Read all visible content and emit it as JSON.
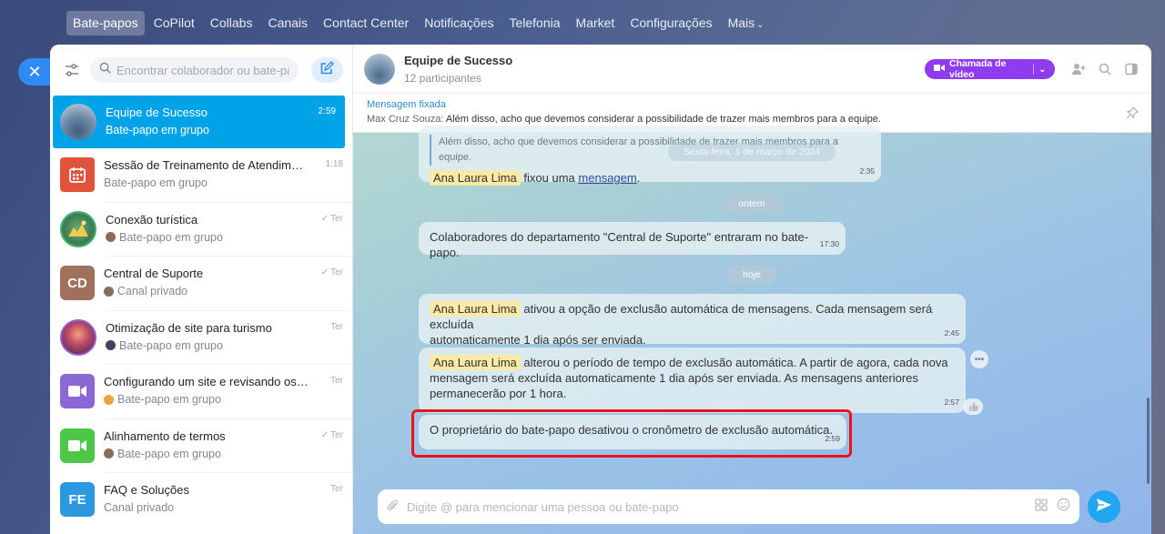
{
  "topnav": {
    "items": [
      "Bate-papos",
      "CoPilot",
      "Collabs",
      "Canais",
      "Contact Center",
      "Notificações",
      "Telefonia",
      "Market",
      "Configurações"
    ],
    "more": "Mais"
  },
  "sidebar": {
    "search_placeholder": "Encontrar colaborador ou bate-papo",
    "chats": [
      {
        "title": "Equipe de Sucesso",
        "subtitle": "Bate-papo em grupo",
        "time": "2:59"
      },
      {
        "title": "Sessão de Treinamento de Atendimento",
        "subtitle": "Bate-papo em grupo",
        "time": "1:18"
      },
      {
        "title": "Conexão turística",
        "subtitle": "Bate-papo em grupo",
        "time": "Ter"
      },
      {
        "title": "Central de Suporte",
        "subtitle": "Canal privado",
        "time": "Ter",
        "initials": "CD"
      },
      {
        "title": "Otimização de site para turismo",
        "subtitle": "Bate-papo em grupo",
        "time": "Ter"
      },
      {
        "title": "Configurando um site e revisando os textos",
        "subtitle": "Bate-papo em grupo",
        "time": "Ter"
      },
      {
        "title": "Alinhamento de termos",
        "subtitle": "Bate-papo em grupo",
        "time": "Ter"
      },
      {
        "title": "FAQ e Soluções",
        "subtitle": "Canal privado",
        "time": "Ter",
        "initials": "FE"
      }
    ]
  },
  "header": {
    "title": "Equipe de Sucesso",
    "participants": "12 participantes",
    "video_button": "Chamada de vídeo"
  },
  "pinned": {
    "label": "Mensagem fixada",
    "author": "Max Cruz Souza:",
    "text": "Além disso, acho que devemos considerar a possibilidade de trazer mais membros para a equipe."
  },
  "messages": {
    "m1": {
      "quote": "Além disso, acho que devemos considerar a possibilidade de trazer mais membros para a equipe.",
      "name": "Ana Laura Lima",
      "action": "fixou uma",
      "link": "mensagem",
      "time": "2:35"
    },
    "date_old": "Sexta-feira, 1 de março de 2024",
    "date_yesterday": "ontem",
    "m2": {
      "text": "Colaboradores do departamento \"Central de Suporte\" entraram no bate-papo.",
      "time": "17:30"
    },
    "date_today": "hoje",
    "m3": {
      "name": "Ana Laura Lima",
      "line1": "ativou a opção de exclusão automática de mensagens. Cada mensagem será excluída",
      "line2": "automaticamente 1 dia após ser enviada.",
      "time": "2:45"
    },
    "m4": {
      "name": "Ana Laura Lima",
      "line1": "alterou o período de tempo de exclusão automática. A partir de agora, cada nova",
      "line2": "mensagem será excluída automaticamente 1 dia após ser enviada. As mensagens anteriores",
      "line3": "permanecerão por 1 hora.",
      "time": "2:57"
    },
    "m5": {
      "text": "O proprietário do bate-papo desativou o cronômetro de exclusão automática.",
      "time": "2:59"
    }
  },
  "composer": {
    "placeholder": "Digite @ para mencionar uma pessoa ou bate-papo"
  },
  "colors": {
    "accent": "#00a2e8",
    "video": "#8f3bf0",
    "highlight_box": "#e8141b"
  }
}
